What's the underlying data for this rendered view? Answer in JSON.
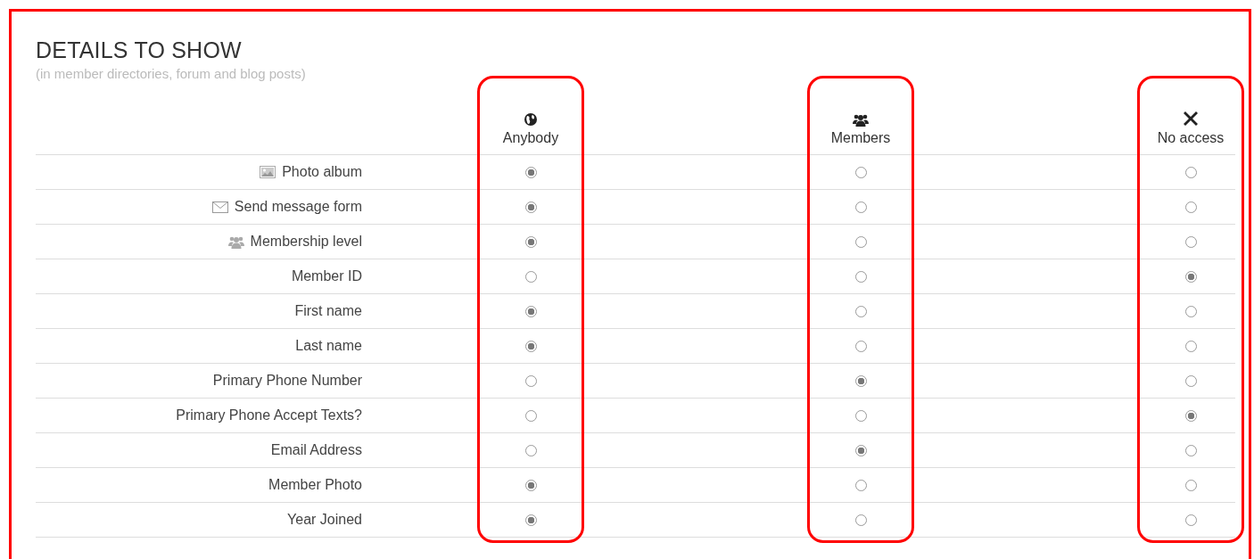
{
  "title": "DETAILS TO SHOW",
  "subtitle": "(in member directories, forum and blog posts)",
  "columns": [
    {
      "label": "Anybody",
      "kind": "globe",
      "highlighted": true
    },
    {
      "label": "Members",
      "kind": "group",
      "highlighted": true
    },
    {
      "label": "No access",
      "kind": "cross",
      "highlighted": true
    }
  ],
  "rows": [
    {
      "label": "Photo album",
      "kind": "photo",
      "options": [
        {
          "selected": true
        },
        {
          "selected": false
        },
        {
          "selected": false
        }
      ]
    },
    {
      "label": "Send message form",
      "kind": "envelope",
      "options": [
        {
          "selected": true
        },
        {
          "selected": false
        },
        {
          "selected": false
        }
      ]
    },
    {
      "label": "Membership level",
      "kind": "group",
      "options": [
        {
          "selected": true
        },
        {
          "selected": false
        },
        {
          "selected": false
        }
      ]
    },
    {
      "label": "Member ID",
      "options": [
        {
          "selected": false
        },
        {
          "selected": false
        },
        {
          "selected": true
        }
      ]
    },
    {
      "label": "First name",
      "options": [
        {
          "selected": true
        },
        {
          "selected": false
        },
        {
          "selected": false
        }
      ]
    },
    {
      "label": "Last name",
      "options": [
        {
          "selected": true
        },
        {
          "selected": false
        },
        {
          "selected": false
        }
      ]
    },
    {
      "label": "Primary Phone Number",
      "options": [
        {
          "selected": false
        },
        {
          "selected": true
        },
        {
          "selected": false
        }
      ]
    },
    {
      "label": "Primary Phone Accept Texts?",
      "options": [
        {
          "selected": false
        },
        {
          "selected": false
        },
        {
          "selected": true
        }
      ]
    },
    {
      "label": "Email Address",
      "options": [
        {
          "selected": false
        },
        {
          "selected": true
        },
        {
          "selected": false
        }
      ]
    },
    {
      "label": "Member Photo",
      "options": [
        {
          "selected": true
        },
        {
          "selected": false
        },
        {
          "selected": false
        }
      ]
    },
    {
      "label": "Year Joined",
      "options": [
        {
          "selected": true
        },
        {
          "selected": false
        },
        {
          "selected": false
        }
      ]
    }
  ]
}
